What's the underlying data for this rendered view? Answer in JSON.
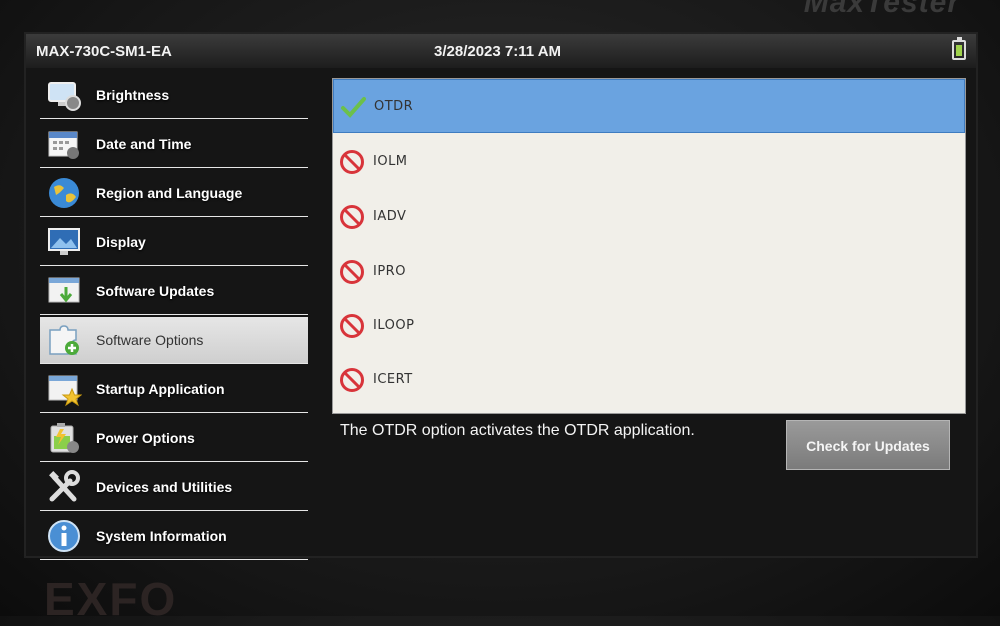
{
  "header": {
    "device_name": "MAX-730C-SM1-EA",
    "datetime": "3/28/2023 7:11 AM",
    "brand_top": "MaxTester"
  },
  "sidebar": {
    "items": [
      {
        "label": "Brightness",
        "icon": "brightness-icon",
        "active": false
      },
      {
        "label": "Date and Time",
        "icon": "calendar-icon",
        "active": false
      },
      {
        "label": "Region and Language",
        "icon": "globe-icon",
        "active": false
      },
      {
        "label": "Display",
        "icon": "monitor-icon",
        "active": false
      },
      {
        "label": "Software Updates",
        "icon": "download-icon",
        "active": false
      },
      {
        "label": "Software Options",
        "icon": "puzzle-icon",
        "active": true
      },
      {
        "label": "Startup Application",
        "icon": "startup-icon",
        "active": false
      },
      {
        "label": "Power Options",
        "icon": "power-icon",
        "active": false
      },
      {
        "label": "Devices and Utilities",
        "icon": "tools-icon",
        "active": false
      },
      {
        "label": "System Information",
        "icon": "info-icon",
        "active": false
      }
    ]
  },
  "options": {
    "items": [
      {
        "label": "OTDR",
        "status": "enabled",
        "selected": true
      },
      {
        "label": "IOLM",
        "status": "disabled",
        "selected": false
      },
      {
        "label": "IADV",
        "status": "disabled",
        "selected": false
      },
      {
        "label": "IPRO",
        "status": "disabled",
        "selected": false
      },
      {
        "label": "ILOOP",
        "status": "disabled",
        "selected": false
      },
      {
        "label": "ICERT",
        "status": "disabled",
        "selected": false
      }
    ],
    "description": "The OTDR option activates the OTDR application.",
    "check_updates_label": "Check for Updates"
  },
  "footer": {
    "brand_bottom": "EXFO"
  },
  "colors": {
    "selected_row": "#6aa3e0",
    "check": "#6cc04a",
    "prohibited": "#d8343a",
    "battery": "#9fd24b"
  }
}
